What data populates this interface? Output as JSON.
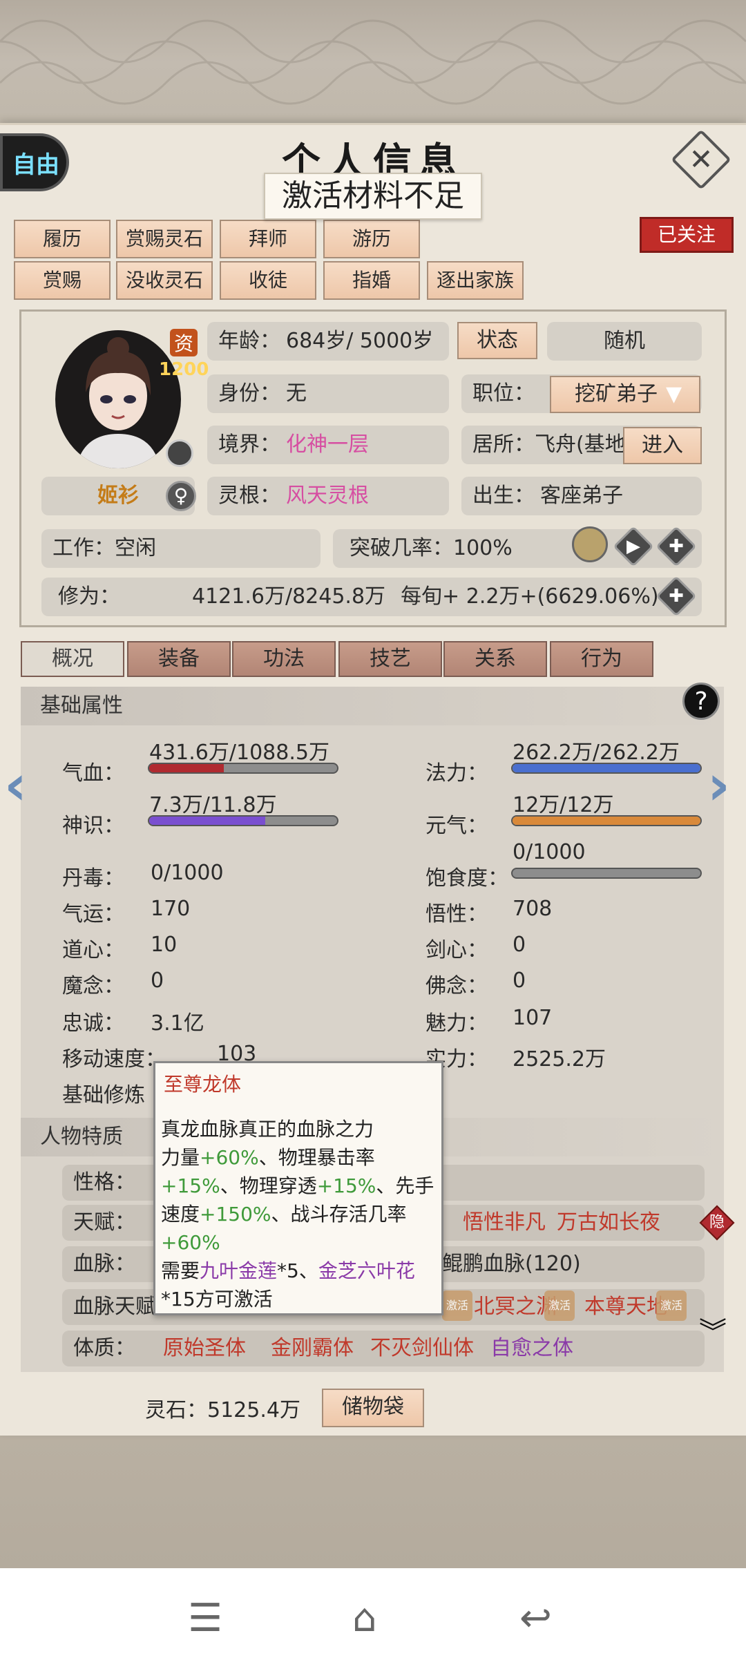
{
  "header": {
    "mode_label": "自由",
    "title": "个人信息",
    "close_icon": "close-icon",
    "toast": "激活材料不足",
    "follow_label": "已关注"
  },
  "toolbar": {
    "row1": [
      "履历",
      "赏赐灵石",
      "拜师",
      "游历"
    ],
    "row2": [
      "赏赐",
      "没收灵石",
      "收徒",
      "指婚",
      "逐出家族"
    ]
  },
  "profile": {
    "aptitude_label": "资",
    "aptitude_value": "1200",
    "name": "姬衫",
    "gender_icon": "female-icon",
    "age_label": "年龄：",
    "age_value": "684岁/ 5000岁",
    "status_button": "状态",
    "random_button": "随机",
    "identity_label": "身份：",
    "identity_value": "无",
    "position_label": "职位：",
    "position_value": "挖矿弟子",
    "realm_label": "境界：",
    "realm_value": "化神一层",
    "residence_label": "居所：",
    "residence_value": "飞舟(基地",
    "enter_button": "进入",
    "root_label": "灵根：",
    "root_value": "风天灵根",
    "birth_label": "出生：",
    "birth_value": "客座弟子",
    "work_label": "工作：",
    "work_value": "空闲",
    "breakthrough_label": "突破几率：",
    "breakthrough_value": "100%",
    "cultivation_label": "修为：",
    "cultivation_value": "4121.6万/8245.8万",
    "per_turn": "每旬+ 2.2万+(6629.06%)"
  },
  "tabs": [
    "概况",
    "装备",
    "功法",
    "技艺",
    "关系",
    "行为"
  ],
  "basic": {
    "title": "基础属性",
    "qixue_label": "气血：",
    "qixue_value": "431.6万/1088.5万",
    "qixue_fill": 0.397,
    "qixue_color": "#b02a30",
    "fali_label": "法力：",
    "fali_value": "262.2万/262.2万",
    "fali_fill": 1.0,
    "fali_color": "#4a6fcf",
    "shenshi_label": "神识：",
    "shenshi_value": "7.3万/11.8万",
    "shenshi_fill": 0.619,
    "shenshi_color": "#7a4fd0",
    "yuanqi_label": "元气：",
    "yuanqi_value": "12万/12万",
    "yuanqi_fill": 1.0,
    "yuanqi_color": "#d9893a",
    "satiety_label": "饱食度：",
    "satiety_value": "0/1000",
    "satiety_fill": 0,
    "stats_left": [
      [
        "丹毒：",
        "0/1000"
      ],
      [
        "气运：",
        "170"
      ],
      [
        "道心：",
        "10"
      ],
      [
        "魔念：",
        "0"
      ],
      [
        "忠诚：",
        "3.1亿"
      ],
      [
        "移动速度：",
        "103"
      ]
    ],
    "stats_right": [
      [
        "悟性：",
        "708"
      ],
      [
        "剑心：",
        "0"
      ],
      [
        "佛念：",
        "0"
      ],
      [
        "魅力：",
        "107"
      ],
      [
        "实力：",
        "2525.2万"
      ]
    ],
    "base_cult_label": "基础修炼"
  },
  "traits": {
    "title": "人物特质",
    "personality_label": "性格：",
    "talent_label": "天赋：",
    "talent_values": [
      "悟性非凡",
      "万古如长夜"
    ],
    "hide_label": "隐",
    "bloodline_label": "血脉：",
    "bloodline_value": "鲲鹏血脉(120)",
    "bloodline_talent_label": "血脉天赋",
    "bloodline_talent_values": [
      "北冥之渊",
      "本尊天地"
    ],
    "activate_label": "激活",
    "physique_label": "体质：",
    "physique_values": [
      "原始圣体",
      "金刚霸体",
      "不灭剑仙体",
      "自愈之体"
    ]
  },
  "tooltip": {
    "title": "至尊龙体",
    "l1": "真龙血脉真正的血脉之力",
    "l2a": "力量",
    "l2b": "+60%",
    "l2c": "、物理暴击率",
    "l3a": "+15%",
    "l3b": "、物理穿透",
    "l3c": "+15%",
    "l3d": "、先手",
    "l4a": "速度",
    "l4b": "+150%",
    "l4c": "、战斗存活几率",
    "l5": "+60%",
    "l6a": "需要",
    "l6b": "九叶金莲",
    "l6c": "*5、",
    "l6d": "金芝六叶花",
    "l7": "*15方可激活"
  },
  "footer": {
    "stone_label": "灵石：",
    "stone_value": "5125.4万",
    "bag_button": "储物袋"
  },
  "navbar": {
    "menu_icon": "menu-icon",
    "home_icon": "home-icon",
    "back_icon": "back-icon"
  }
}
